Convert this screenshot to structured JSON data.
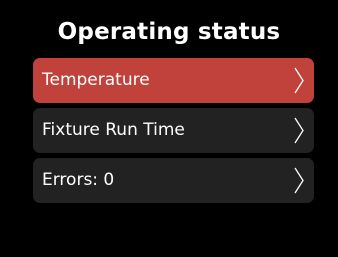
{
  "header": {
    "title": "Operating status"
  },
  "menu": {
    "items": [
      {
        "label": "Temperature",
        "selected": true,
        "icon": "chevron-right-icon"
      },
      {
        "label": "Fixture Run Time",
        "selected": false,
        "icon": "chevron-right-icon"
      },
      {
        "label": "Errors: 0",
        "selected": false,
        "icon": "chevron-right-icon"
      }
    ]
  },
  "colors": {
    "background": "#000000",
    "item_background": "#222222",
    "selected_background": "#c0423a",
    "text": "#ffffff"
  }
}
